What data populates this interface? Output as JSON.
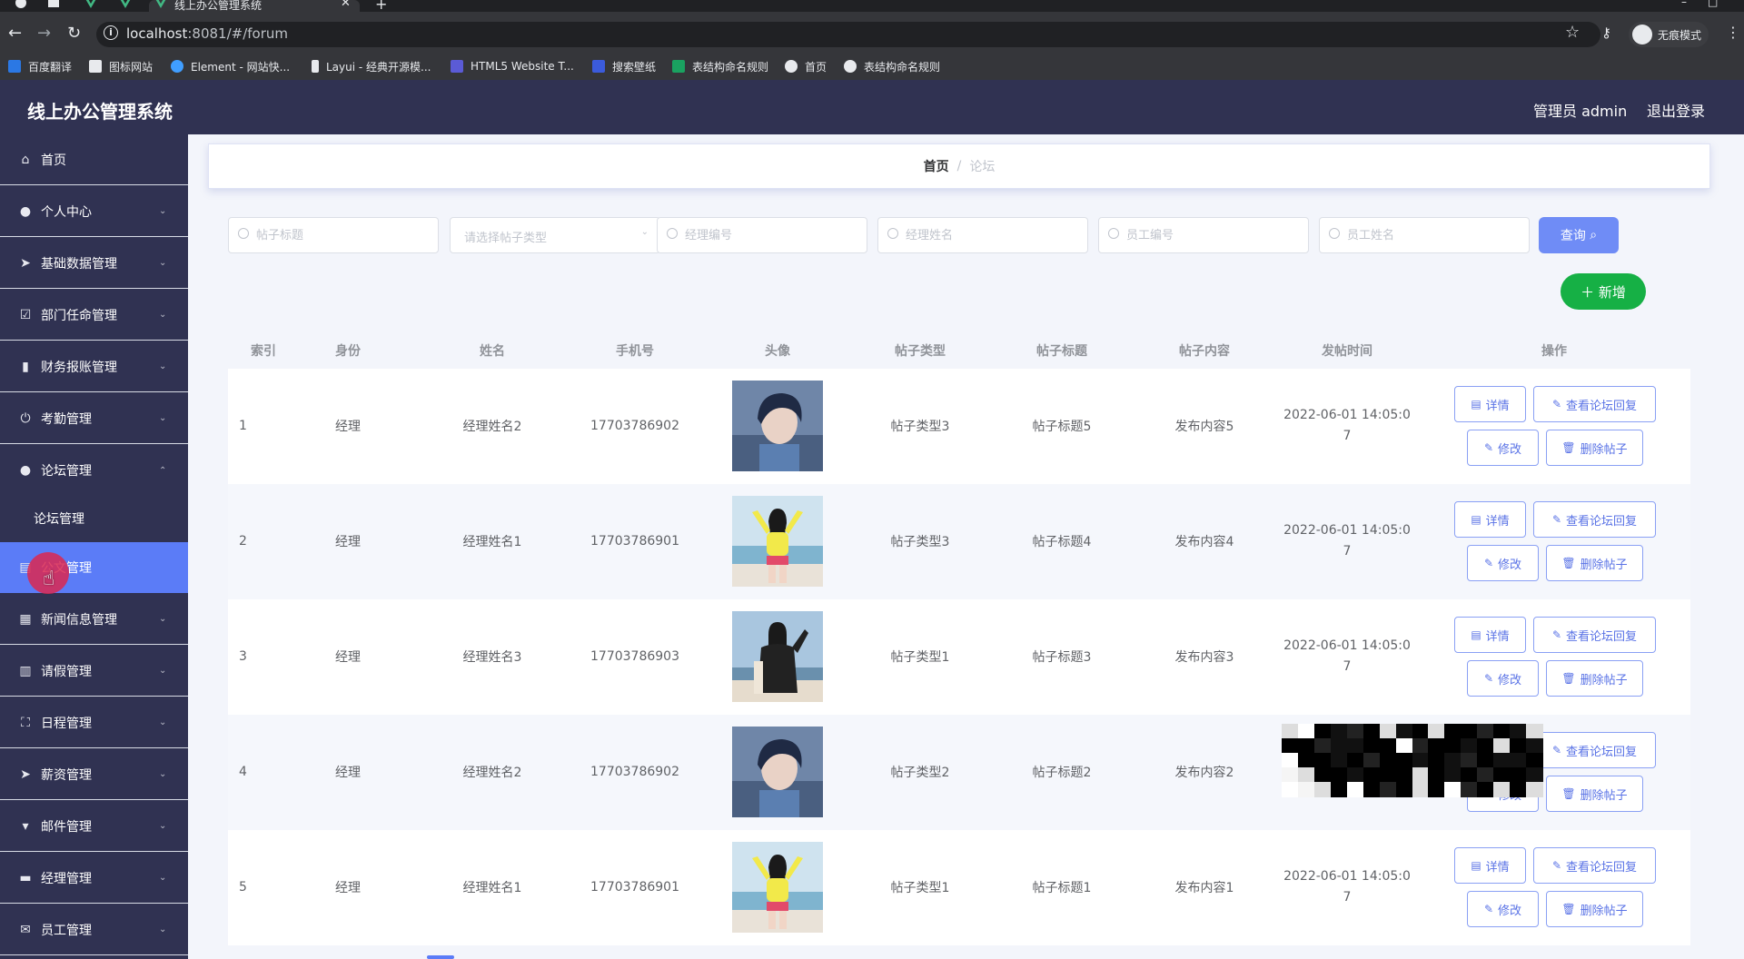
{
  "browser": {
    "tab_title": "线上办公管理系统",
    "url_host": "localhost",
    "url_rest": ":8081/#/forum",
    "incognito_label": "无痕模式",
    "bookmarks": [
      {
        "label": "百度翻译",
        "color": "#2b78e4"
      },
      {
        "label": "图标网站",
        "color": "#e8eaed"
      },
      {
        "label": "Element - 网站快...",
        "color": "#409eff"
      },
      {
        "label": "Layui - 经典开源模...",
        "color": "#e8eaed"
      },
      {
        "label": "HTML5 Website T...",
        "color": "#5b5bd6"
      },
      {
        "label": "搜索壁纸",
        "color": "#3b5bdb"
      },
      {
        "label": "表结构命名规则",
        "color": "#1aa260"
      },
      {
        "label": "首页",
        "color": "#e8eaed"
      },
      {
        "label": "表结构命名规则",
        "color": "#e8eaed"
      }
    ]
  },
  "app": {
    "title": "线上办公管理系统",
    "user": "管理员 admin",
    "logout": "退出登录"
  },
  "sidebar": {
    "items": [
      {
        "label": "首页",
        "icon": "home-icon"
      },
      {
        "label": "个人中心",
        "icon": "user-icon"
      },
      {
        "label": "基础数据管理",
        "icon": "send-icon"
      },
      {
        "label": "部门任命管理",
        "icon": "checkbox-icon"
      },
      {
        "label": "财务报账管理",
        "icon": "money-icon"
      },
      {
        "label": "考勤管理",
        "icon": "power-icon"
      },
      {
        "label": "论坛管理",
        "icon": "user-icon"
      },
      {
        "label": "公文管理",
        "icon": "document-icon"
      },
      {
        "label": "新闻信息管理",
        "icon": "grid-icon"
      },
      {
        "label": "请假管理",
        "icon": "clipboard-icon"
      },
      {
        "label": "日程管理",
        "icon": "expand-icon"
      },
      {
        "label": "薪资管理",
        "icon": "send-icon"
      },
      {
        "label": "邮件管理",
        "icon": "stamp-icon"
      },
      {
        "label": "经理管理",
        "icon": "chat-icon"
      },
      {
        "label": "员工管理",
        "icon": "mail-icon"
      }
    ],
    "sub_item": "论坛管理"
  },
  "breadcrumb": {
    "home": "首页",
    "separator": "/",
    "current": "论坛"
  },
  "filters": {
    "post_title_placeholder": "帖子标题",
    "post_type_placeholder": "请选择帖子类型",
    "manager_no_placeholder": "经理编号",
    "manager_name_placeholder": "经理姓名",
    "staff_no_placeholder": "员工编号",
    "staff_name_placeholder": "员工姓名",
    "query_label": "查询",
    "add_label": "新增"
  },
  "table": {
    "headers": [
      "索引",
      "身份",
      "姓名",
      "手机号",
      "头像",
      "帖子类型",
      "帖子标题",
      "帖子内容",
      "发帖时间",
      "操作"
    ],
    "rows": [
      {
        "index": "1",
        "role": "经理",
        "name": "经理姓名2",
        "phone": "17703786902",
        "avatar": "boy",
        "type": "帖子类型3",
        "title": "帖子标题5",
        "content": "发布内容5",
        "time_a": "2022-06-01 14:05:0",
        "time_b": "7"
      },
      {
        "index": "2",
        "role": "经理",
        "name": "经理姓名1",
        "phone": "17703786901",
        "avatar": "girl-yellow",
        "type": "帖子类型3",
        "title": "帖子标题4",
        "content": "发布内容4",
        "time_a": "2022-06-01 14:05:0",
        "time_b": "7"
      },
      {
        "index": "3",
        "role": "经理",
        "name": "经理姓名3",
        "phone": "17703786903",
        "avatar": "girl-black",
        "type": "帖子类型1",
        "title": "帖子标题3",
        "content": "发布内容3",
        "time_a": "2022-06-01 14:05:0",
        "time_b": "7"
      },
      {
        "index": "4",
        "role": "经理",
        "name": "经理姓名2",
        "phone": "17703786902",
        "avatar": "boy",
        "type": "帖子类型2",
        "title": "帖子标题2",
        "content": "发布内容2",
        "time_a": "",
        "time_b": ""
      },
      {
        "index": "5",
        "role": "经理",
        "name": "经理姓名1",
        "phone": "17703786901",
        "avatar": "girl-yellow",
        "type": "帖子类型1",
        "title": "帖子标题1",
        "content": "发布内容1",
        "time_a": "2022-06-01 14:05:0",
        "time_b": "7"
      }
    ],
    "actions": {
      "detail": "详情",
      "view_replies": "查看论坛回复",
      "edit": "修改",
      "delete": "删除帖子"
    }
  },
  "colors": {
    "header_bg": "#303252",
    "accent": "#5b7cf7",
    "add_green": "#16b045"
  }
}
